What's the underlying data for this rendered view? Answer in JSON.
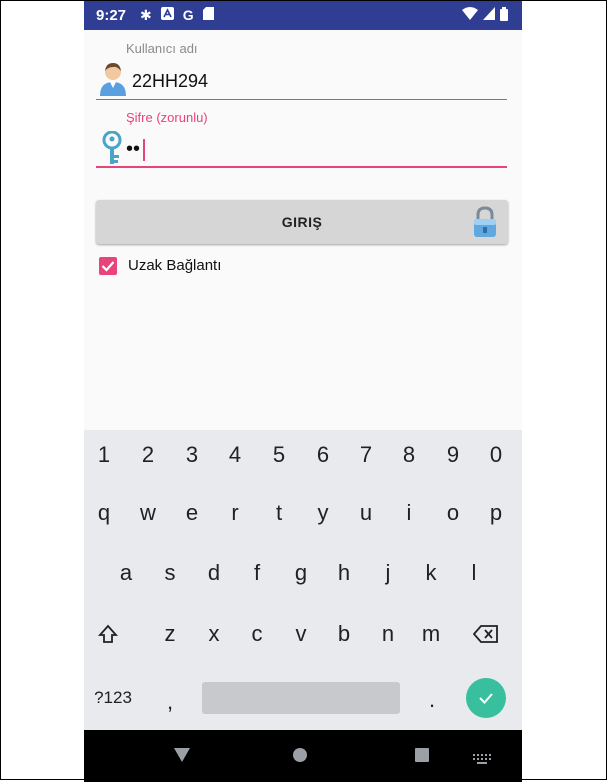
{
  "status": {
    "time": "9:27",
    "icons": [
      "gear-icon",
      "a-icon",
      "google-icon",
      "sdcard-icon"
    ],
    "right_icons": [
      "wifi-icon",
      "signal-icon",
      "battery-icon"
    ]
  },
  "form": {
    "username_label": "Kullanıcı adı",
    "username_value": "22HH294",
    "password_label": "Şifre (zorunlu)",
    "password_value": "••",
    "login_label": "GIRIŞ",
    "remote_label": "Uzak Bağlantı",
    "remote_checked": true,
    "accent_color": "#e8437a",
    "status_color": "#2f3d93"
  },
  "keyboard": {
    "row_numbers": [
      "1",
      "2",
      "3",
      "4",
      "5",
      "6",
      "7",
      "8",
      "9",
      "0"
    ],
    "row_top": [
      "q",
      "w",
      "e",
      "r",
      "t",
      "y",
      "u",
      "i",
      "o",
      "p"
    ],
    "row_home": [
      "a",
      "s",
      "d",
      "f",
      "g",
      "h",
      "j",
      "k",
      "l"
    ],
    "row_bottom": [
      "z",
      "x",
      "c",
      "v",
      "b",
      "n",
      "m"
    ],
    "symbols_label": "?123",
    "comma": ",",
    "period": "."
  },
  "navbar": {
    "buttons": [
      "back-icon",
      "home-icon",
      "recents-icon",
      "keyboard-switch-icon"
    ]
  }
}
